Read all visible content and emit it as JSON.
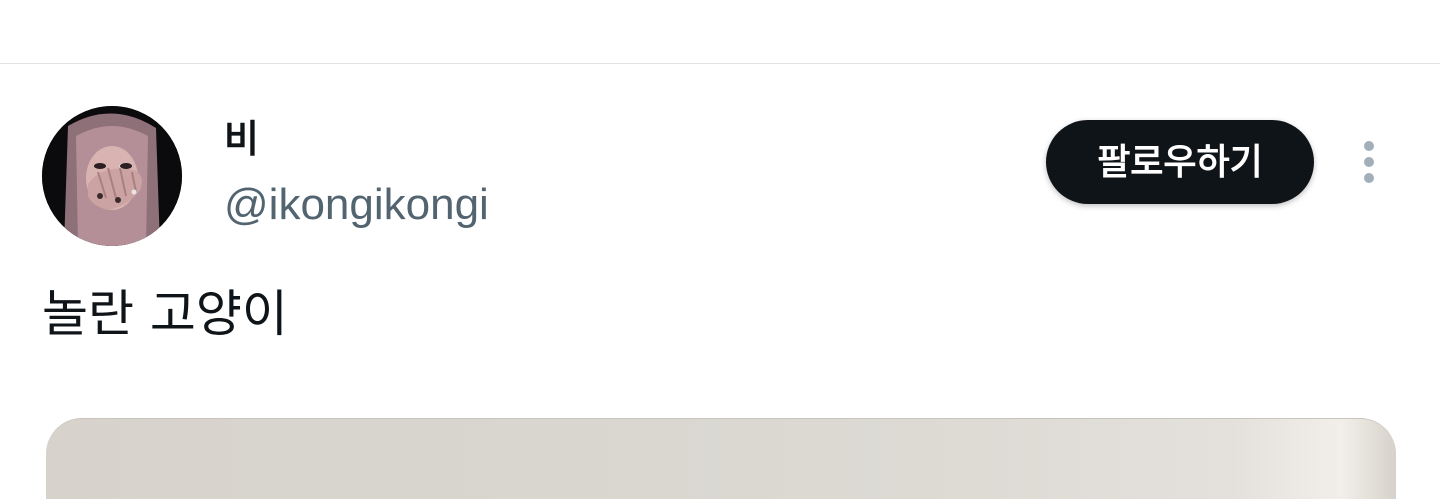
{
  "tweet": {
    "author": {
      "display_name": "비",
      "handle": "@ikongikongi"
    },
    "follow_label": "팔로우하기",
    "more_icon": "more-vertical-icon",
    "text": "놀란 고양이"
  },
  "colors": {
    "text_primary": "#0f1419",
    "text_secondary": "#536471",
    "follow_bg": "#0f1419",
    "follow_text": "#ffffff",
    "divider": "#dfe3e6",
    "more_icon": "#a2aeb8"
  }
}
